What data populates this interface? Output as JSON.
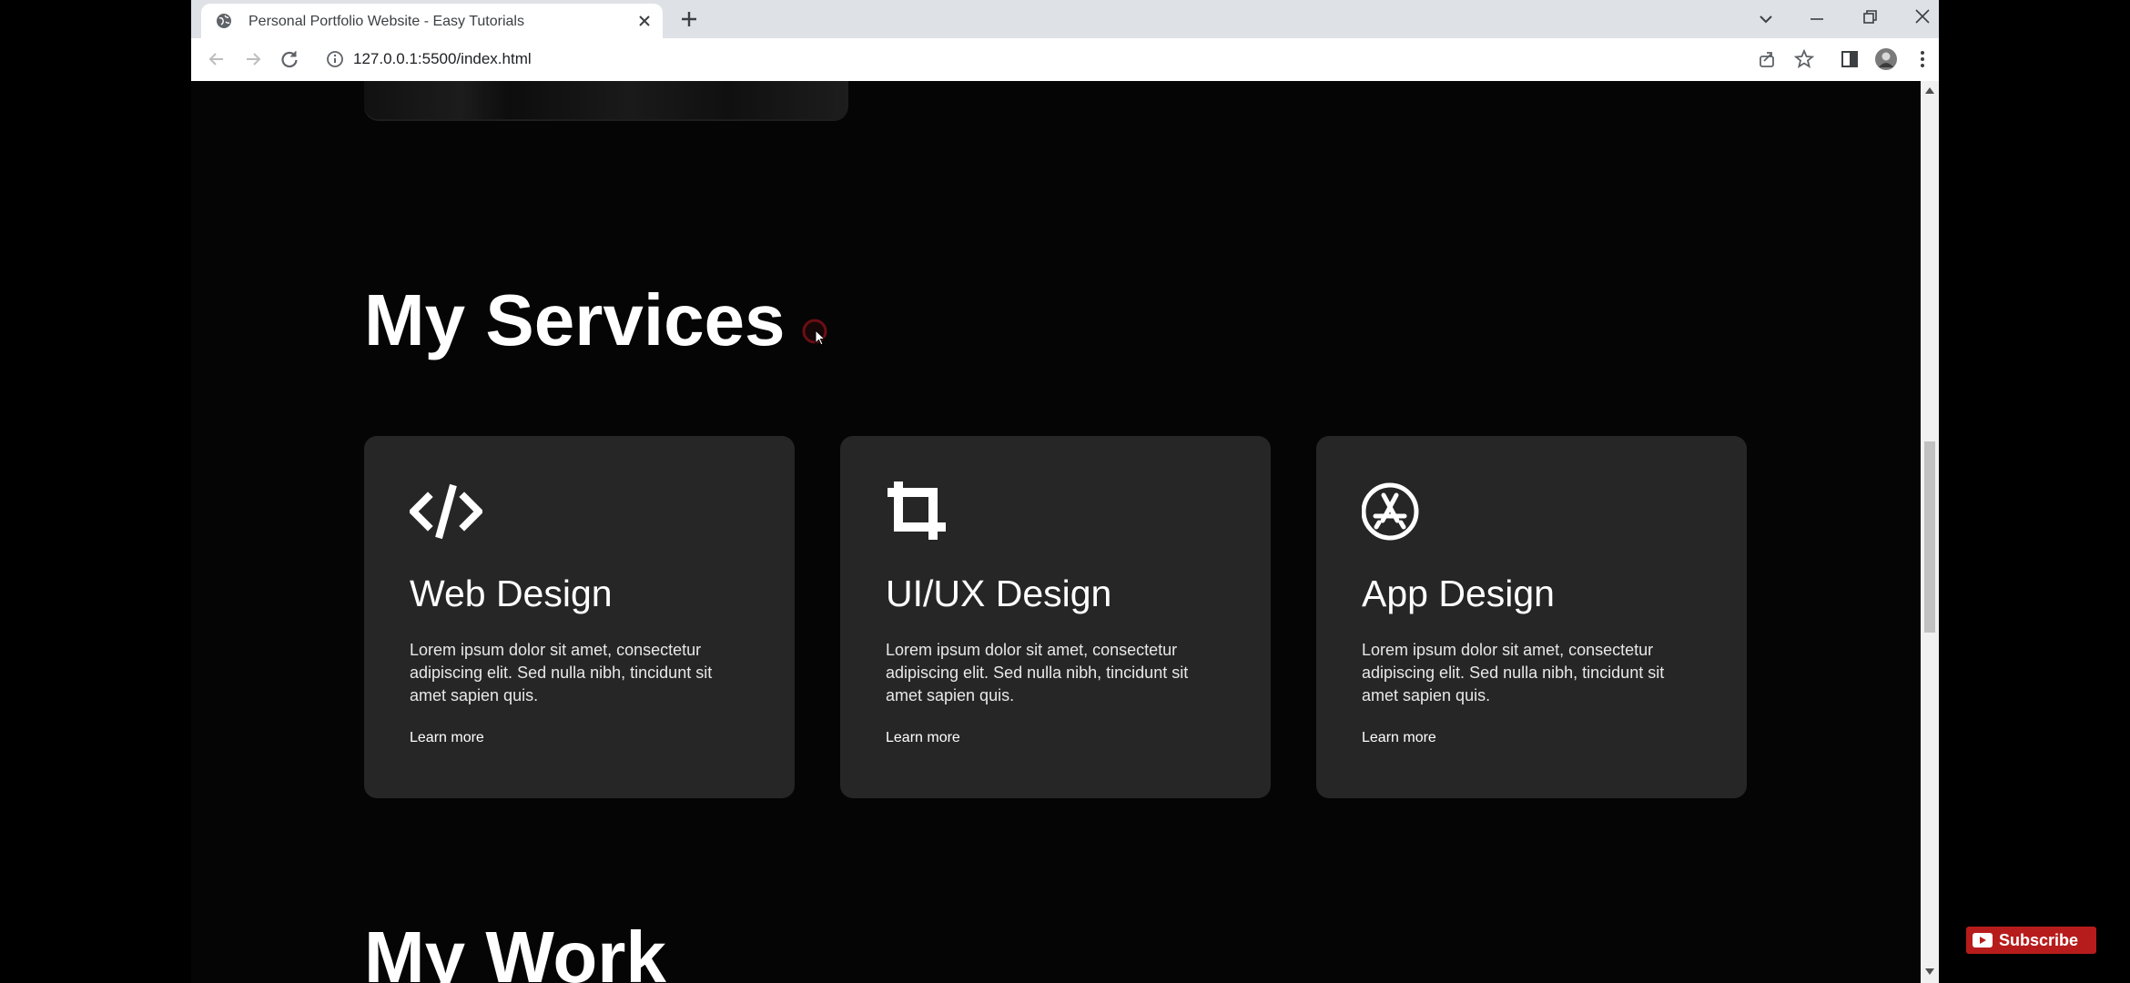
{
  "browser": {
    "tab": {
      "title": "Personal Portfolio Website - Easy Tutorials"
    },
    "address": {
      "url": "127.0.0.1:5500/index.html"
    }
  },
  "page": {
    "services_title": "My Services",
    "services": [
      {
        "icon": "code-icon",
        "title": "Web Design",
        "description": "Lorem ipsum dolor sit amet, consectetur adipiscing elit. Sed nulla nibh, tincidunt sit amet sapien quis.",
        "link": "Learn more"
      },
      {
        "icon": "crop-icon",
        "title": "UI/UX Design",
        "description": "Lorem ipsum dolor sit amet, consectetur adipiscing elit. Sed nulla nibh, tincidunt sit amet sapien quis.",
        "link": "Learn more"
      },
      {
        "icon": "app-store-icon",
        "title": "App Design",
        "description": "Lorem ipsum dolor sit amet, consectetur adipiscing elit. Sed nulla nibh, tincidunt sit amet sapien quis.",
        "link": "Learn more"
      }
    ],
    "work_title": "My Work"
  },
  "overlay": {
    "subscribe_label": "Subscribe"
  },
  "colors": {
    "page_bg": "#050505",
    "card_bg": "#262626",
    "subscribe_red": "#b71c1c"
  }
}
